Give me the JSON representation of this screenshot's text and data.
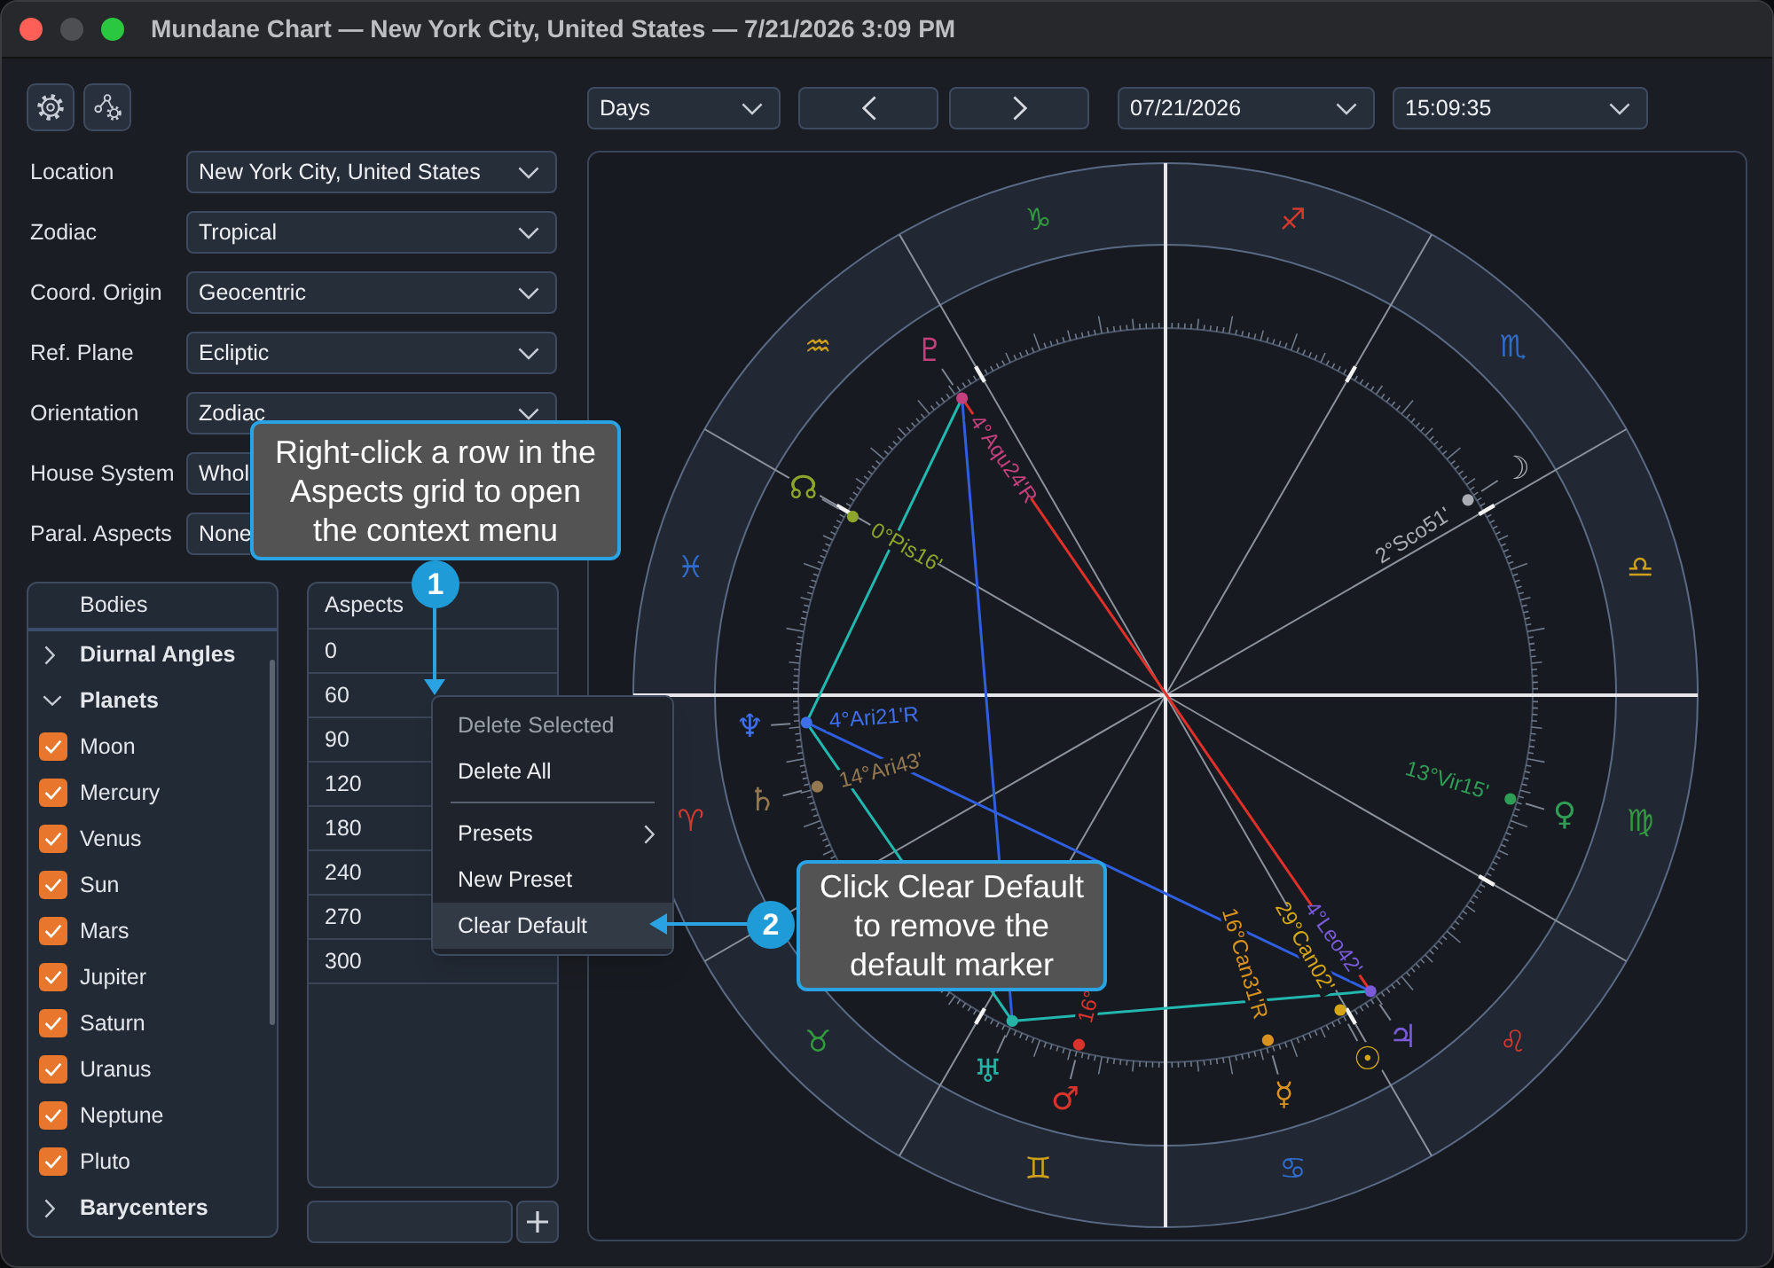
{
  "window": {
    "title": "Mundane Chart — New York City, United States — 7/21/2026 3:09 PM"
  },
  "settings_fields": [
    {
      "label": "Location",
      "value": "New York City, United States"
    },
    {
      "label": "Zodiac",
      "value": "Tropical"
    },
    {
      "label": "Coord. Origin",
      "value": "Geocentric"
    },
    {
      "label": "Ref. Plane",
      "value": "Ecliptic"
    },
    {
      "label": "Orientation",
      "value": "Zodiac"
    },
    {
      "label": "House System",
      "value": "Whol"
    },
    {
      "label": "Paral. Aspects",
      "value": "None"
    }
  ],
  "bodies": {
    "header": "Bodies",
    "items": [
      {
        "label": "Diurnal Angles",
        "expanded": false
      },
      {
        "label": "Planets",
        "expanded": true,
        "children": [
          {
            "label": "Moon",
            "checked": true
          },
          {
            "label": "Mercury",
            "checked": true
          },
          {
            "label": "Venus",
            "checked": true
          },
          {
            "label": "Sun",
            "checked": true
          },
          {
            "label": "Mars",
            "checked": true
          },
          {
            "label": "Jupiter",
            "checked": true
          },
          {
            "label": "Saturn",
            "checked": true
          },
          {
            "label": "Uranus",
            "checked": true
          },
          {
            "label": "Neptune",
            "checked": true
          },
          {
            "label": "Pluto",
            "checked": true
          }
        ]
      },
      {
        "label": "Barycenters",
        "expanded": false
      }
    ]
  },
  "aspects": {
    "header": "Aspects",
    "rows": [
      {
        "value": "0",
        "selected": false
      },
      {
        "value": "60",
        "selected": false
      },
      {
        "value": "90",
        "selected": false
      },
      {
        "value": "120",
        "selected": false
      },
      {
        "value": "180",
        "selected": false
      },
      {
        "value": "240",
        "selected": false
      },
      {
        "value": "270",
        "selected": false
      },
      {
        "value": "300",
        "selected": false
      }
    ]
  },
  "context_menu": {
    "items": [
      {
        "kind": "action",
        "label": "Delete Selected",
        "disabled": true,
        "highlighted": false
      },
      {
        "kind": "action",
        "label": "Delete All",
        "disabled": false,
        "highlighted": false
      },
      {
        "kind": "separator"
      },
      {
        "kind": "submenu",
        "label": "Presets",
        "disabled": false,
        "highlighted": false
      },
      {
        "kind": "action",
        "label": "New Preset",
        "disabled": false,
        "highlighted": false
      },
      {
        "kind": "action",
        "label": "Clear Default",
        "disabled": false,
        "highlighted": true
      }
    ]
  },
  "toolbar": {
    "step_unit": "Days",
    "date": "07/21/2026",
    "time": "15:09:35"
  },
  "chart": {
    "zodiac_signs": [
      {
        "glyph": "♈",
        "color": "#d23a30"
      },
      {
        "glyph": "♉",
        "color": "#33993f"
      },
      {
        "glyph": "♊",
        "color": "#cfa11b"
      },
      {
        "glyph": "♋",
        "color": "#2f6ccc"
      },
      {
        "glyph": "♌",
        "color": "#d23a30"
      },
      {
        "glyph": "♍",
        "color": "#33993f"
      },
      {
        "glyph": "♎",
        "color": "#cfa11b"
      },
      {
        "glyph": "♏",
        "color": "#2f6ccc"
      },
      {
        "glyph": "♐",
        "color": "#d23a30"
      },
      {
        "glyph": "♑",
        "color": "#33993f"
      },
      {
        "glyph": "♒",
        "color": "#cfa11b"
      },
      {
        "glyph": "♓",
        "color": "#2f6ccc"
      }
    ],
    "points": [
      {
        "glyph": "♆",
        "label": "4°Ari21'R",
        "color": "#3f6fe8"
      },
      {
        "glyph": "♄",
        "label": "14°Ari43'",
        "color": "#94784f"
      },
      {
        "glyph": "♅",
        "color": "#27b3a6"
      },
      {
        "glyph": "♂",
        "label": "16°",
        "color": "#d8342c"
      },
      {
        "glyph": "☿",
        "label": "16°Can31'R",
        "color": "#d9911f"
      },
      {
        "glyph": "☉",
        "label": "29°Can02'",
        "color": "#d4a514"
      },
      {
        "glyph": "♃",
        "label": "4°Leo42'",
        "color": "#7a5ad8"
      },
      {
        "glyph": "♀",
        "label": "13°Vir15'",
        "color": "#2f9d55"
      },
      {
        "glyph": "☽",
        "label": "2°Sco51'",
        "color": "#a9acb2"
      },
      {
        "glyph": "♇",
        "label": "4°Aqu24'R",
        "color": "#c2407c"
      },
      {
        "glyph": "☊",
        "label": "0°Pis16'",
        "color": "#8da52a"
      }
    ]
  },
  "callouts": [
    {
      "number": "1",
      "text": "Right-click a row in the Aspects grid to open the context menu"
    },
    {
      "number": "2",
      "text": "Click Clear Default to remove the default marker"
    }
  ]
}
